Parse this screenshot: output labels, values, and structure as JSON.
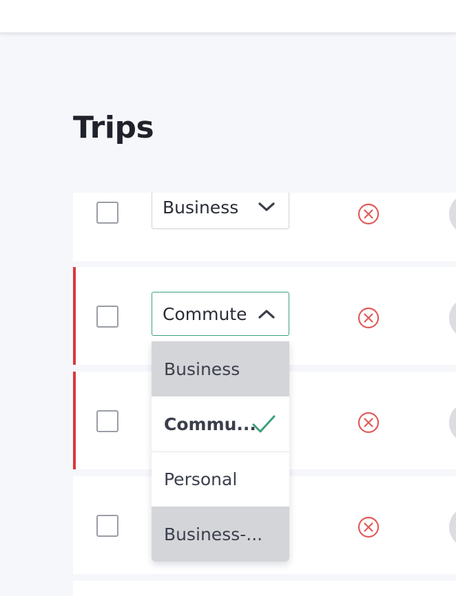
{
  "page": {
    "title": "Trips"
  },
  "trips": [
    {
      "type": "Business",
      "flagged": false
    },
    {
      "type": "Commute",
      "flagged": true,
      "dropdown_open": true
    },
    {
      "type": "",
      "flagged": true
    },
    {
      "type": "",
      "flagged": false
    }
  ],
  "dropdown": {
    "options": [
      {
        "label": "Business",
        "state": "hover"
      },
      {
        "label": "Commu...",
        "state": "selected"
      },
      {
        "label": "Personal",
        "state": "normal"
      },
      {
        "label": "Business-...",
        "state": "hover"
      }
    ]
  },
  "colors": {
    "accent": "#3aa078",
    "flag": "#d63b3b",
    "remove": "#e25b5b",
    "background": "#f6f7fb"
  },
  "icons": {
    "select_closed": "chevron-down-icon",
    "select_open": "chevron-up-icon",
    "remove": "remove-circle-icon",
    "selected": "check-icon"
  }
}
